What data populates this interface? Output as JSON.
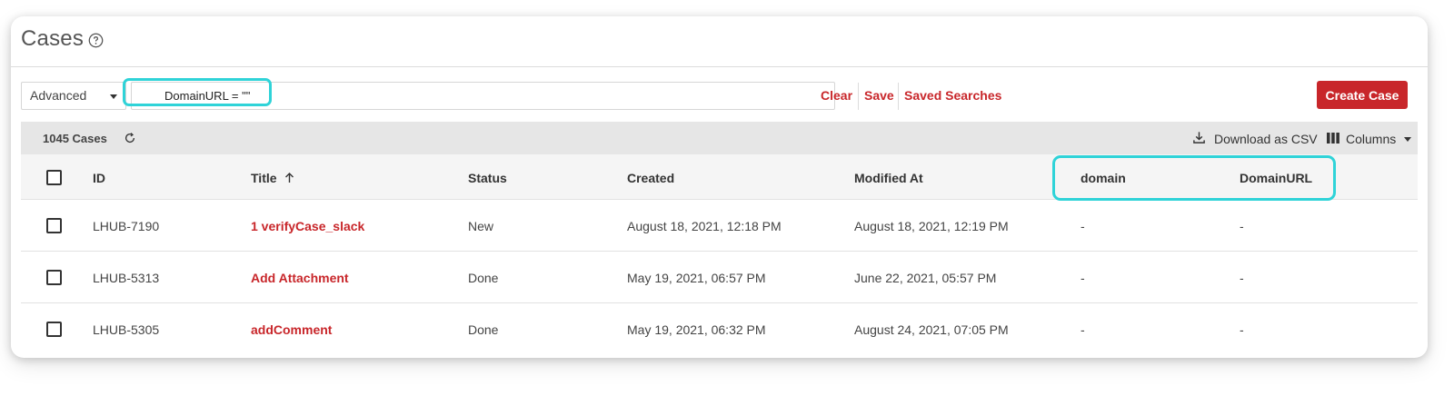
{
  "page": {
    "title": "Cases"
  },
  "toolbar": {
    "mode": "Advanced",
    "search_value": "DomainURL = \"\"",
    "clear_label": "Clear",
    "save_label": "Save",
    "saved_searches_label": "Saved Searches",
    "create_label": "Create Case"
  },
  "summary": {
    "count_label": "1045 Cases",
    "download_label": "Download as CSV",
    "columns_label": "Columns"
  },
  "table": {
    "headers": {
      "id": "ID",
      "title": "Title",
      "status": "Status",
      "created": "Created",
      "modified": "Modified At",
      "domain": "domain",
      "domainurl": "DomainURL"
    },
    "rows": [
      {
        "id": "LHUB-7190",
        "title": "1 verifyCase_slack",
        "status": "New",
        "created": "August 18, 2021, 12:18 PM",
        "modified": "August 18, 2021, 12:19 PM",
        "domain": "-",
        "domainurl": "-"
      },
      {
        "id": "LHUB-5313",
        "title": "Add Attachment",
        "status": "Done",
        "created": "May 19, 2021, 06:57 PM",
        "modified": "June 22, 2021, 05:57 PM",
        "domain": "-",
        "domainurl": "-"
      },
      {
        "id": "LHUB-5305",
        "title": "addComment",
        "status": "Done",
        "created": "May 19, 2021, 06:32 PM",
        "modified": "August 24, 2021, 07:05 PM",
        "domain": "-",
        "domainurl": "-"
      }
    ]
  },
  "icons": {
    "help": "question-circle-icon",
    "refresh": "refresh-icon",
    "download": "download-icon",
    "columns": "columns-icon",
    "sort": "arrow-up-icon"
  },
  "colors": {
    "accent": "#c8262a",
    "highlight": "#2fd3d8"
  }
}
